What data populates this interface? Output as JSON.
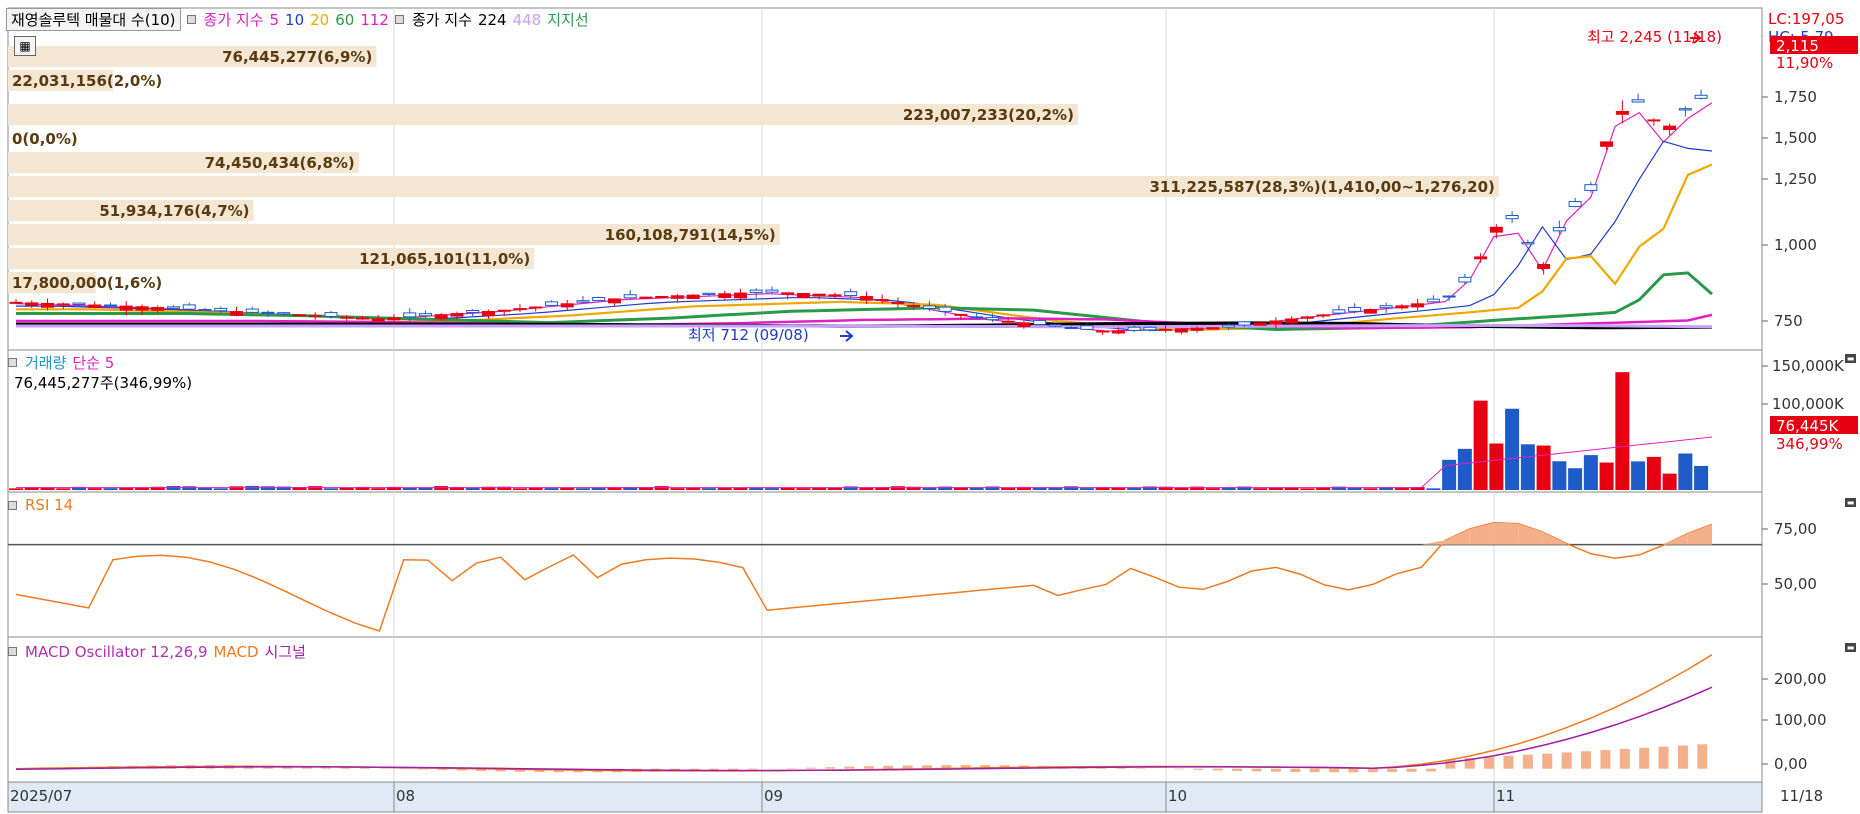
{
  "legend": {
    "stock_name": "재영솔루텍 매물대 수(10)",
    "ma_title": "종가 지수",
    "ma_periods": [
      "5",
      "10",
      "20",
      "60",
      "112"
    ],
    "ma_colors": [
      "#e020c0",
      "#1e3cc8",
      "#f0a800",
      "#2a9a4a",
      "#e020c0"
    ],
    "ma2_title": "종가 지수",
    "ma2_periods": [
      "224",
      "448"
    ],
    "ma2_colors": [
      "#000000",
      "#c9a0ff"
    ],
    "support_label": "지지선"
  },
  "volume_profile": [
    {
      "label": "76,445,277(6,9%)"
    },
    {
      "label": "22,031,156(2,0%)"
    },
    {
      "label": "223,007,233(20,2%)"
    },
    {
      "label": "0(0,0%)"
    },
    {
      "label": "74,450,434(6,8%)"
    },
    {
      "label": "311,225,587(28,3%)(1,410,00~1,276,20)"
    },
    {
      "label": "51,934,176(4,7%)"
    },
    {
      "label": "160,108,791(14,5%)"
    },
    {
      "label": "121,065,101(11,0%)"
    },
    {
      "label": "17,800,000(1,6%)"
    }
  ],
  "annotations": {
    "high": "최고 2,245 (11/18)",
    "low": "최저 712 (09/08)"
  },
  "right_axis": {
    "lc": "LC:197,05",
    "hc": "HC:-5,79",
    "price_tag": "2,115",
    "price_pct": "11,90%",
    "price_ticks": [
      "1,750",
      "1,500",
      "1,250",
      "1,000",
      "750"
    ],
    "volume_ticks": [
      "150,000K",
      "100,000K"
    ],
    "volume_tag": "76,445K",
    "volume_pct": "346,99%",
    "rsi_ticks": [
      "75,00",
      "50,00"
    ],
    "macd_ticks": [
      "200,00",
      "100,00",
      "0,00"
    ]
  },
  "volume_panel": {
    "title": "거래량",
    "ma_label": "단순 5",
    "summary": "76,445,277주(346,99%)"
  },
  "rsi_panel": {
    "title": "RSI 14"
  },
  "macd_panel": {
    "osc_label": "MACD Oscillator 12,26,9",
    "macd_label": "MACD",
    "signal_label": "시그널"
  },
  "x_axis": {
    "labels": [
      "2025/07",
      "08",
      "09",
      "10",
      "11",
      "11/18"
    ]
  },
  "colors": {
    "up": "#e60012",
    "down": "#1e5ac8",
    "grid": "#d8d8d8",
    "profile": "#f3e6d2"
  },
  "chart_data": {
    "type": "candlestick",
    "price_range": [
      650,
      2300
    ],
    "high": 2245,
    "low": 712,
    "last_close": 2115,
    "volume_range": [
      0,
      160000000
    ],
    "rsi_range": [
      30,
      92
    ],
    "macd_range": [
      -25,
      280
    ]
  }
}
